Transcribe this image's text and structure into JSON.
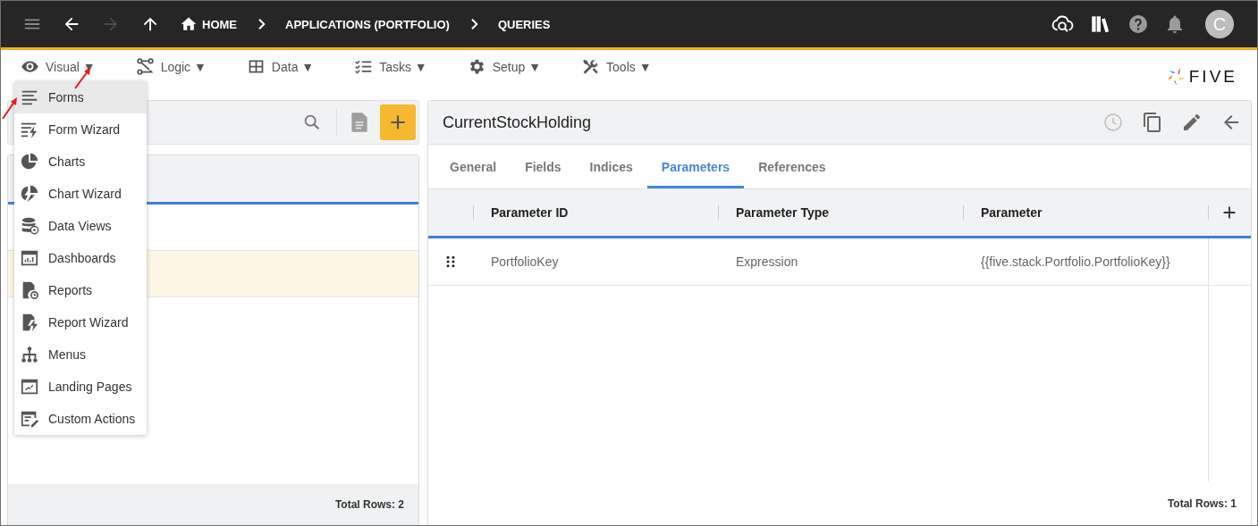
{
  "topbar": {
    "nav": [
      {
        "kind": "menu",
        "disabled": false
      },
      {
        "kind": "back",
        "disabled": false
      },
      {
        "kind": "forward",
        "disabled": true
      },
      {
        "kind": "up",
        "disabled": false
      }
    ],
    "breadcrumbs": [
      {
        "label": "HOME",
        "kind": "home"
      },
      {
        "label": "APPLICATIONS (PORTFOLIO)",
        "kind": "plain"
      },
      {
        "label": "QUERIES",
        "kind": "plain"
      }
    ],
    "avatar": "C"
  },
  "menubar": [
    {
      "label": "Visual",
      "caret": "▼"
    },
    {
      "label": "Logic",
      "caret": "▼"
    },
    {
      "label": "Data",
      "caret": "▼"
    },
    {
      "label": "Tasks",
      "caret": "▼"
    },
    {
      "label": "Setup",
      "caret": "▼"
    },
    {
      "label": "Tools",
      "caret": "▼"
    }
  ],
  "logo": {
    "text": "FIVE"
  },
  "dropdown": [
    {
      "label": "Forms",
      "selected": true
    },
    {
      "label": "Form Wizard",
      "selected": false
    },
    {
      "label": "Charts",
      "selected": false
    },
    {
      "label": "Chart Wizard",
      "selected": false
    },
    {
      "label": "Data Views",
      "selected": false
    },
    {
      "label": "Dashboards",
      "selected": false
    },
    {
      "label": "Reports",
      "selected": false
    },
    {
      "label": "Report Wizard",
      "selected": false
    },
    {
      "label": "Menus",
      "selected": false
    },
    {
      "label": "Landing Pages",
      "selected": false
    },
    {
      "label": "Custom Actions",
      "selected": false
    }
  ],
  "left_panel": {
    "rows": [
      {
        "selected": false
      },
      {
        "selected": true
      }
    ],
    "footer": "Total Rows: 2"
  },
  "right_panel": {
    "title": "CurrentStockHolding",
    "tabs": [
      {
        "label": "General",
        "selected": false
      },
      {
        "label": "Fields",
        "selected": false
      },
      {
        "label": "Indices",
        "selected": false
      },
      {
        "label": "Parameters",
        "selected": true
      },
      {
        "label": "References",
        "selected": false
      }
    ],
    "table": {
      "columns": [
        "Parameter ID",
        "Parameter Type",
        "Parameter"
      ],
      "rows": [
        {
          "cells": [
            "PortfolioKey",
            "Expression",
            "{{five.stack.Portfolio.PortfolioKey}}"
          ]
        }
      ]
    },
    "footer": "Total Rows: 1"
  }
}
